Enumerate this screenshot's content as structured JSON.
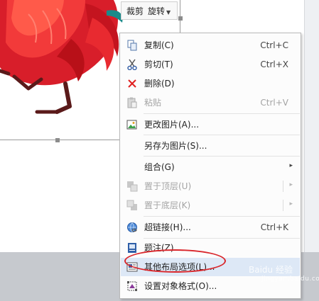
{
  "toolbar": {
    "crop_label": "裁剪",
    "rotate_label": "旋转"
  },
  "menu": {
    "items": [
      {
        "label": "复制(C)",
        "shortcut": "Ctrl+C",
        "icon": "copy-icon",
        "disabled": false
      },
      {
        "label": "剪切(T)",
        "shortcut": "Ctrl+X",
        "icon": "scissors-icon",
        "disabled": false
      },
      {
        "label": "删除(D)",
        "shortcut": "",
        "icon": "delete-x-icon",
        "disabled": false
      },
      {
        "label": "粘贴",
        "shortcut": "Ctrl+V",
        "icon": "paste-icon",
        "disabled": true
      },
      {
        "label": "更改图片(A)...",
        "shortcut": "",
        "icon": "change-picture-icon",
        "disabled": false
      },
      {
        "label": "另存为图片(S)...",
        "shortcut": "",
        "icon": "",
        "disabled": false
      },
      {
        "label": "组合(G)",
        "shortcut": "",
        "icon": "",
        "disabled": false,
        "submenu": true
      },
      {
        "label": "置于顶层(U)",
        "shortcut": "",
        "icon": "bring-to-front-icon",
        "disabled": true,
        "submenu": true
      },
      {
        "label": "置于底层(K)",
        "shortcut": "",
        "icon": "send-to-back-icon",
        "disabled": true,
        "submenu": true
      },
      {
        "label": "超链接(H)...",
        "shortcut": "Ctrl+K",
        "icon": "hyperlink-globe-icon",
        "disabled": false
      },
      {
        "label": "题注(Z)...",
        "shortcut": "",
        "icon": "caption-icon",
        "disabled": false
      },
      {
        "label": "其他布局选项(L)...",
        "shortcut": "",
        "icon": "layout-options-icon",
        "disabled": false,
        "highlighted": true
      },
      {
        "label": "设置对象格式(O)...",
        "shortcut": "",
        "icon": "format-object-icon",
        "disabled": false
      }
    ]
  },
  "colors": {
    "highlight": "#dde8f6",
    "annotation_ellipse": "#d9262b",
    "rooster_red": "#e0202a",
    "rooster_leg": "#5a1a1a"
  },
  "watermark": {
    "text": "Baidu 经验",
    "sub": "jingyan.baidu.com"
  }
}
